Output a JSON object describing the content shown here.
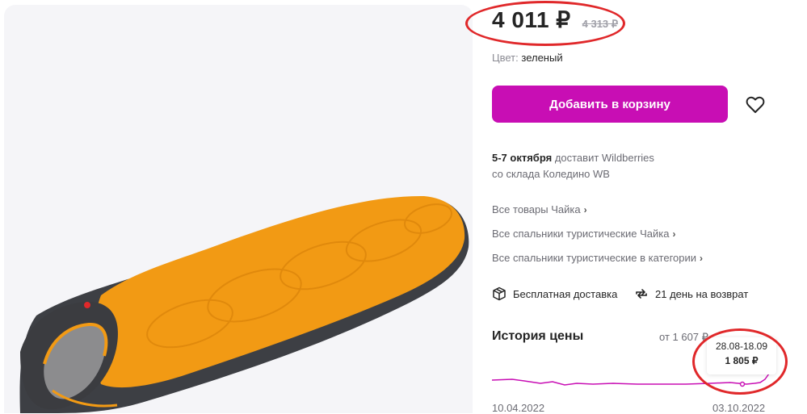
{
  "product": {
    "price": "4 011 ₽",
    "old_price": "4 313 ₽",
    "color_label": "Цвет:",
    "color_value": "зеленый",
    "add_to_cart": "Добавить в корзину",
    "favorite_icon": "heart-icon"
  },
  "delivery": {
    "dates": "5-7 октября",
    "by": "доставит Wildberries",
    "warehouse": "со склада Коледино WB"
  },
  "links": [
    "Все товары Чайка",
    "Все спальники туристические Чайка",
    "Все спальники туристические в категории"
  ],
  "features": {
    "free_delivery": "Бесплатная доставка",
    "free_delivery_icon": "box-icon",
    "return": "21 день на возврат",
    "return_icon": "return-arrows-icon"
  },
  "price_history": {
    "title": "История цены",
    "from_text": "от 1 607 ₽",
    "start_date": "10.04.2022",
    "end_date": "03.10.2022",
    "tooltip_date": "28.08-18.09",
    "tooltip_price": "1 805 ₽",
    "line_color": "#c80eb4"
  },
  "colors": {
    "accent": "#c80eb4",
    "annotation": "#e0282a"
  }
}
